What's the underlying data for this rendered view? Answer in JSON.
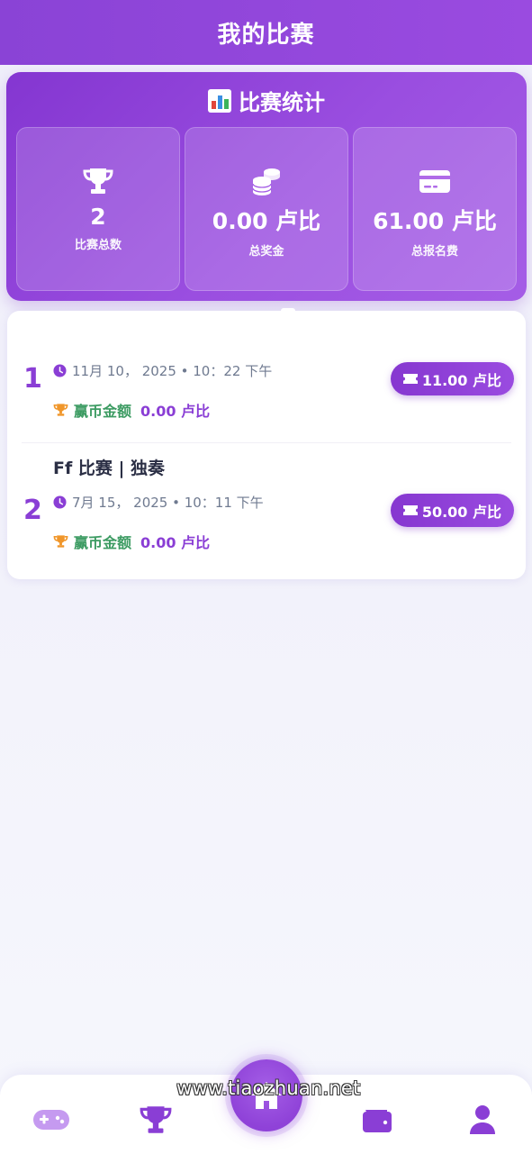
{
  "header": {
    "title": "我的比赛"
  },
  "stats": {
    "title": "比赛统计",
    "items": [
      {
        "icon": "trophy-icon",
        "value": "2",
        "label": "比赛总数"
      },
      {
        "icon": "coins-icon",
        "value": "0.00 卢比",
        "label": "总奖金"
      },
      {
        "icon": "credit-card-icon",
        "value": "61.00 卢比",
        "label": "总报名费"
      }
    ]
  },
  "matches": [
    {
      "rank": "1",
      "title": "",
      "date": "11月 10， 2025 • 10：22 下午",
      "prize_label": "赢币金额",
      "prize_value": "0.00 卢比",
      "fee": "11.00 卢比"
    },
    {
      "rank": "2",
      "title": "Ff 比赛 | 独奏",
      "date": "7月 15， 2025 • 10：11 下午",
      "prize_label": "赢币金额",
      "prize_value": "0.00 卢比",
      "fee": "50.00 卢比"
    }
  ],
  "nav": {
    "items": [
      "gamepad-icon",
      "trophy-icon",
      "home-icon",
      "wallet-icon",
      "user-icon"
    ],
    "active": "trophy-icon"
  },
  "watermark": "www.tiaozhuan.net",
  "colors": {
    "primary": "#8a3ed5",
    "prize_green": "#3c9b62",
    "trophy_orange": "#f0962a"
  }
}
